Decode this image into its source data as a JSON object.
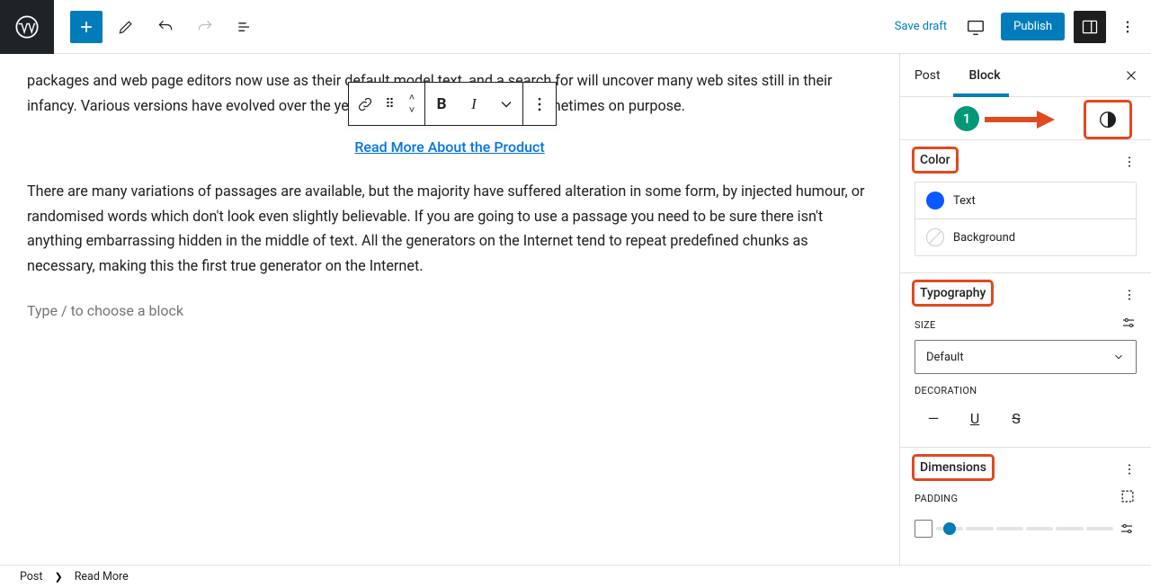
{
  "topbar": {
    "save_draft": "Save draft",
    "publish": "Publish"
  },
  "editor": {
    "para1": "packages and web page editors now use as their default model text, and a search for will uncover many web sites still in their infancy. Various versions have evolved over the years, sometimes by accident, sometimes on purpose.",
    "read_more_link": "Read More About the Product",
    "para2": "There are many variations of passages are available, but the majority have suffered alteration in some form, by injected humour, or randomised words which don't look even slightly believable. If you are going to use a passage you need to be sure there isn't anything embarrassing hidden in the middle of text. All the generators on the Internet tend to repeat predefined chunks as necessary, making this the first true generator on the Internet.",
    "block_prompt": "Type / to choose a block"
  },
  "fmt": {
    "bold": "B",
    "italic": "I"
  },
  "sidebar": {
    "tabs": {
      "post": "Post",
      "block": "Block"
    },
    "annotation": {
      "number": "1"
    },
    "color": {
      "title": "Color",
      "text_label": "Text",
      "background_label": "Background"
    },
    "typography": {
      "title": "Typography",
      "size_label": "SIZE",
      "size_value": "Default",
      "decoration_label": "DECORATION",
      "dash": "—",
      "underline": "U",
      "strike": "S"
    },
    "dimensions": {
      "title": "Dimensions",
      "padding_label": "PADDING"
    }
  },
  "breadcrumb": {
    "root": "Post",
    "leaf": "Read More"
  }
}
